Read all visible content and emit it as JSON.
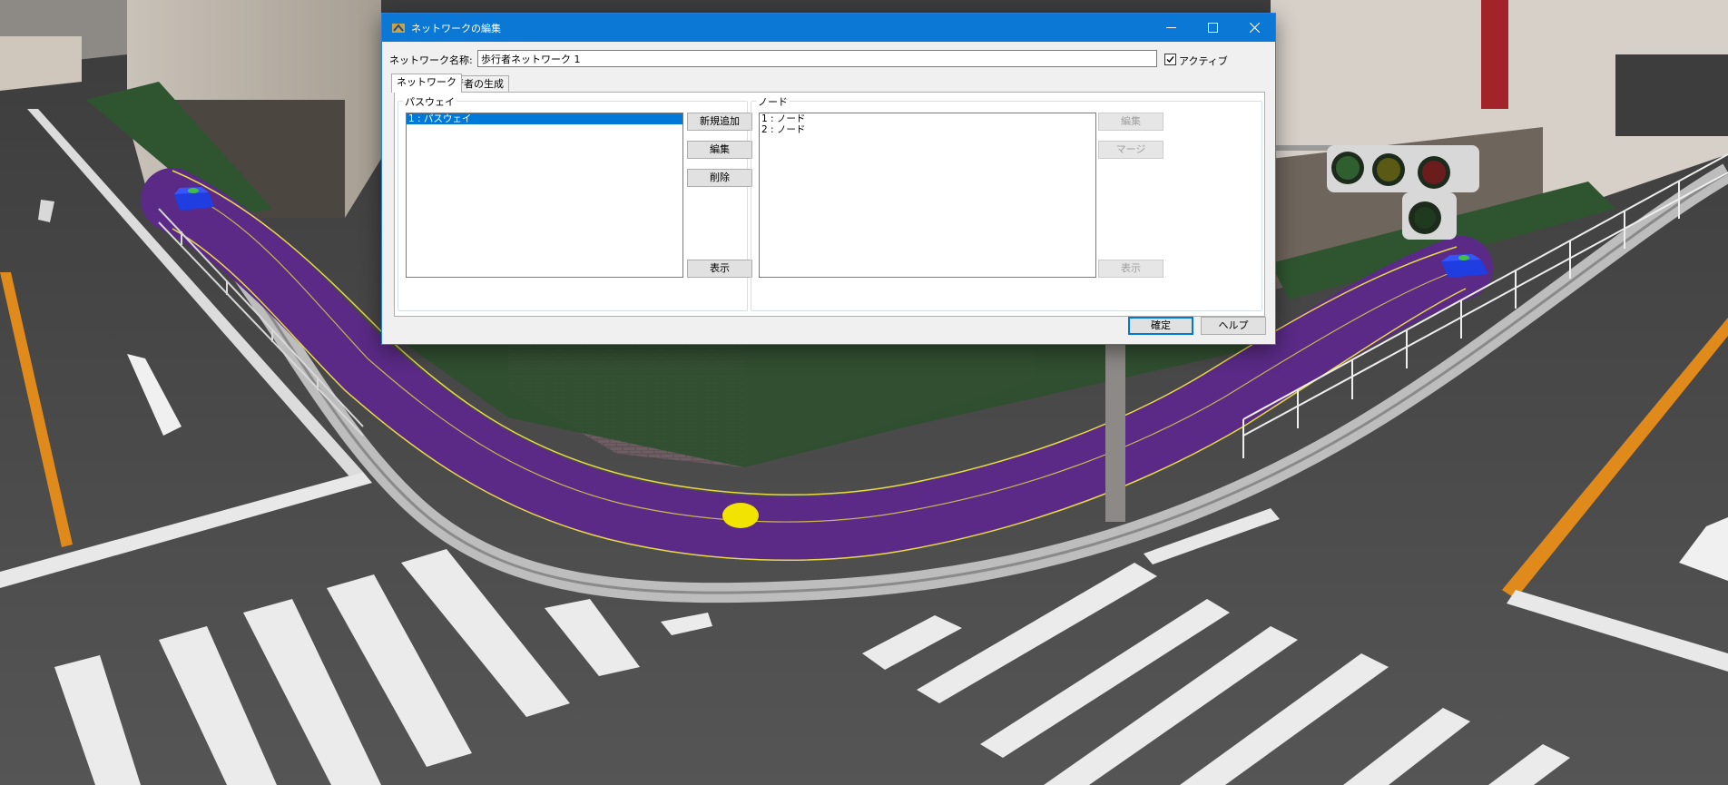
{
  "window": {
    "title": "ネットワークの編集",
    "controls": {
      "minimize": "minimize-icon",
      "maximize": "maximize-icon",
      "close": "close-icon"
    }
  },
  "form": {
    "name_label": "ネットワーク名称:",
    "name_value": "歩行者ネットワーク 1",
    "active_label": "アクティブ",
    "active_checked": true
  },
  "tabs": [
    {
      "label": "ネットワーク",
      "active": true
    },
    {
      "label": "歩行者の生成",
      "active": false
    }
  ],
  "pathway": {
    "group_title": "パスウェイ",
    "items": [
      {
        "label": "1 : パスウェイ",
        "selected": true
      }
    ],
    "buttons": {
      "add": "新規追加",
      "edit": "編集",
      "delete": "削除",
      "show": "表示"
    }
  },
  "node": {
    "group_title": "ノード",
    "items": [
      {
        "label": "1 : ノード"
      },
      {
        "label": "2 : ノード"
      }
    ],
    "buttons": {
      "edit": "編集",
      "merge": "マージ",
      "show": "表示"
    },
    "buttons_enabled": false
  },
  "footer": {
    "ok": "確定",
    "help": "ヘルプ"
  },
  "colors": {
    "titlebar": "#0a78d4",
    "selection": "#0078d7",
    "pathway": "#5a2a86",
    "pathway_edge": "#e8d84a",
    "node_marker": "#1f3de0",
    "agent_marker": "#f2e400",
    "asphalt": "#4c4c4c",
    "grass": "#2f5530"
  }
}
